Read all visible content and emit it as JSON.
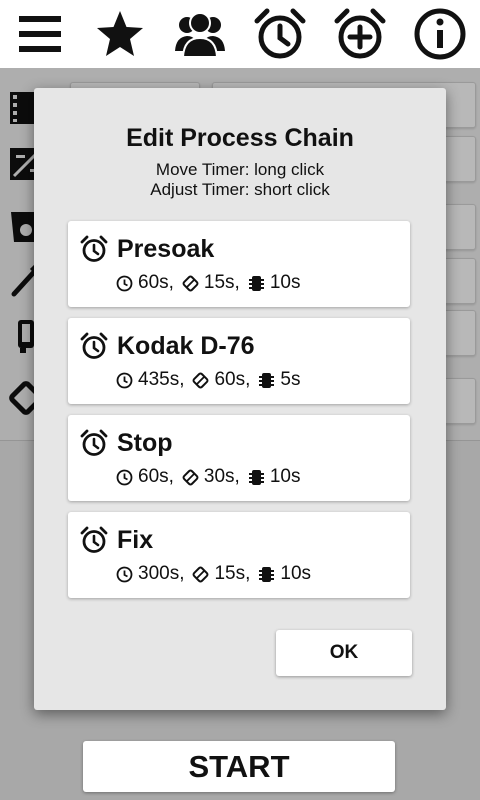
{
  "toolbar": {
    "icons": [
      "menu-icon",
      "star-icon",
      "people-icon",
      "alarm-clock-icon",
      "alarm-add-icon",
      "info-icon"
    ]
  },
  "dialog": {
    "title": "Edit Process Chain",
    "hint_move": "Move Timer: long click",
    "hint_adjust": "Adjust Timer: short click",
    "steps": [
      {
        "name": "Presoak",
        "time": "60s,",
        "agitation": "15s,",
        "drain": "10s"
      },
      {
        "name": "Kodak D-76",
        "time": "435s,",
        "agitation": "60s,",
        "drain": "5s"
      },
      {
        "name": "Stop",
        "time": "60s,",
        "agitation": "30s,",
        "drain": "10s"
      },
      {
        "name": "Fix",
        "time": "300s,",
        "agitation": "15s,",
        "drain": "10s"
      }
    ],
    "ok_label": "OK"
  },
  "start_label": "START"
}
